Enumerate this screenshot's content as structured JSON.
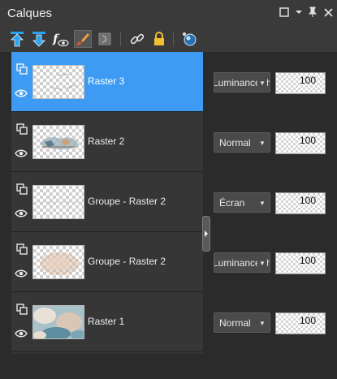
{
  "panel": {
    "title": "Calques",
    "controls": [
      "restore-icon",
      "dropdown-icon",
      "pin-icon",
      "close-icon"
    ]
  },
  "toolbar": {
    "buttons": [
      "move-up-icon",
      "move-down-icon",
      "fx-visibility-icon",
      "brush-icon",
      "mask-icon",
      "link-icon",
      "lock-icon",
      "palette-icon"
    ]
  },
  "layers": [
    {
      "name": "Raster 3",
      "selected": true,
      "blend_mode": "Luminance (h",
      "opacity": "100"
    },
    {
      "name": "Raster 2",
      "selected": false,
      "blend_mode": "Normal",
      "opacity": "100"
    },
    {
      "name": "Groupe - Raster 2",
      "selected": false,
      "blend_mode": "Écran",
      "opacity": "100"
    },
    {
      "name": "Groupe - Raster 2",
      "selected": false,
      "blend_mode": "Luminance (h",
      "opacity": "100"
    },
    {
      "name": "Raster 1",
      "selected": false,
      "blend_mode": "Normal",
      "opacity": "100"
    }
  ],
  "colors": {
    "selected_row": "#3d9bf4",
    "toolbar_blue_arrow": "#2aa3f0"
  }
}
